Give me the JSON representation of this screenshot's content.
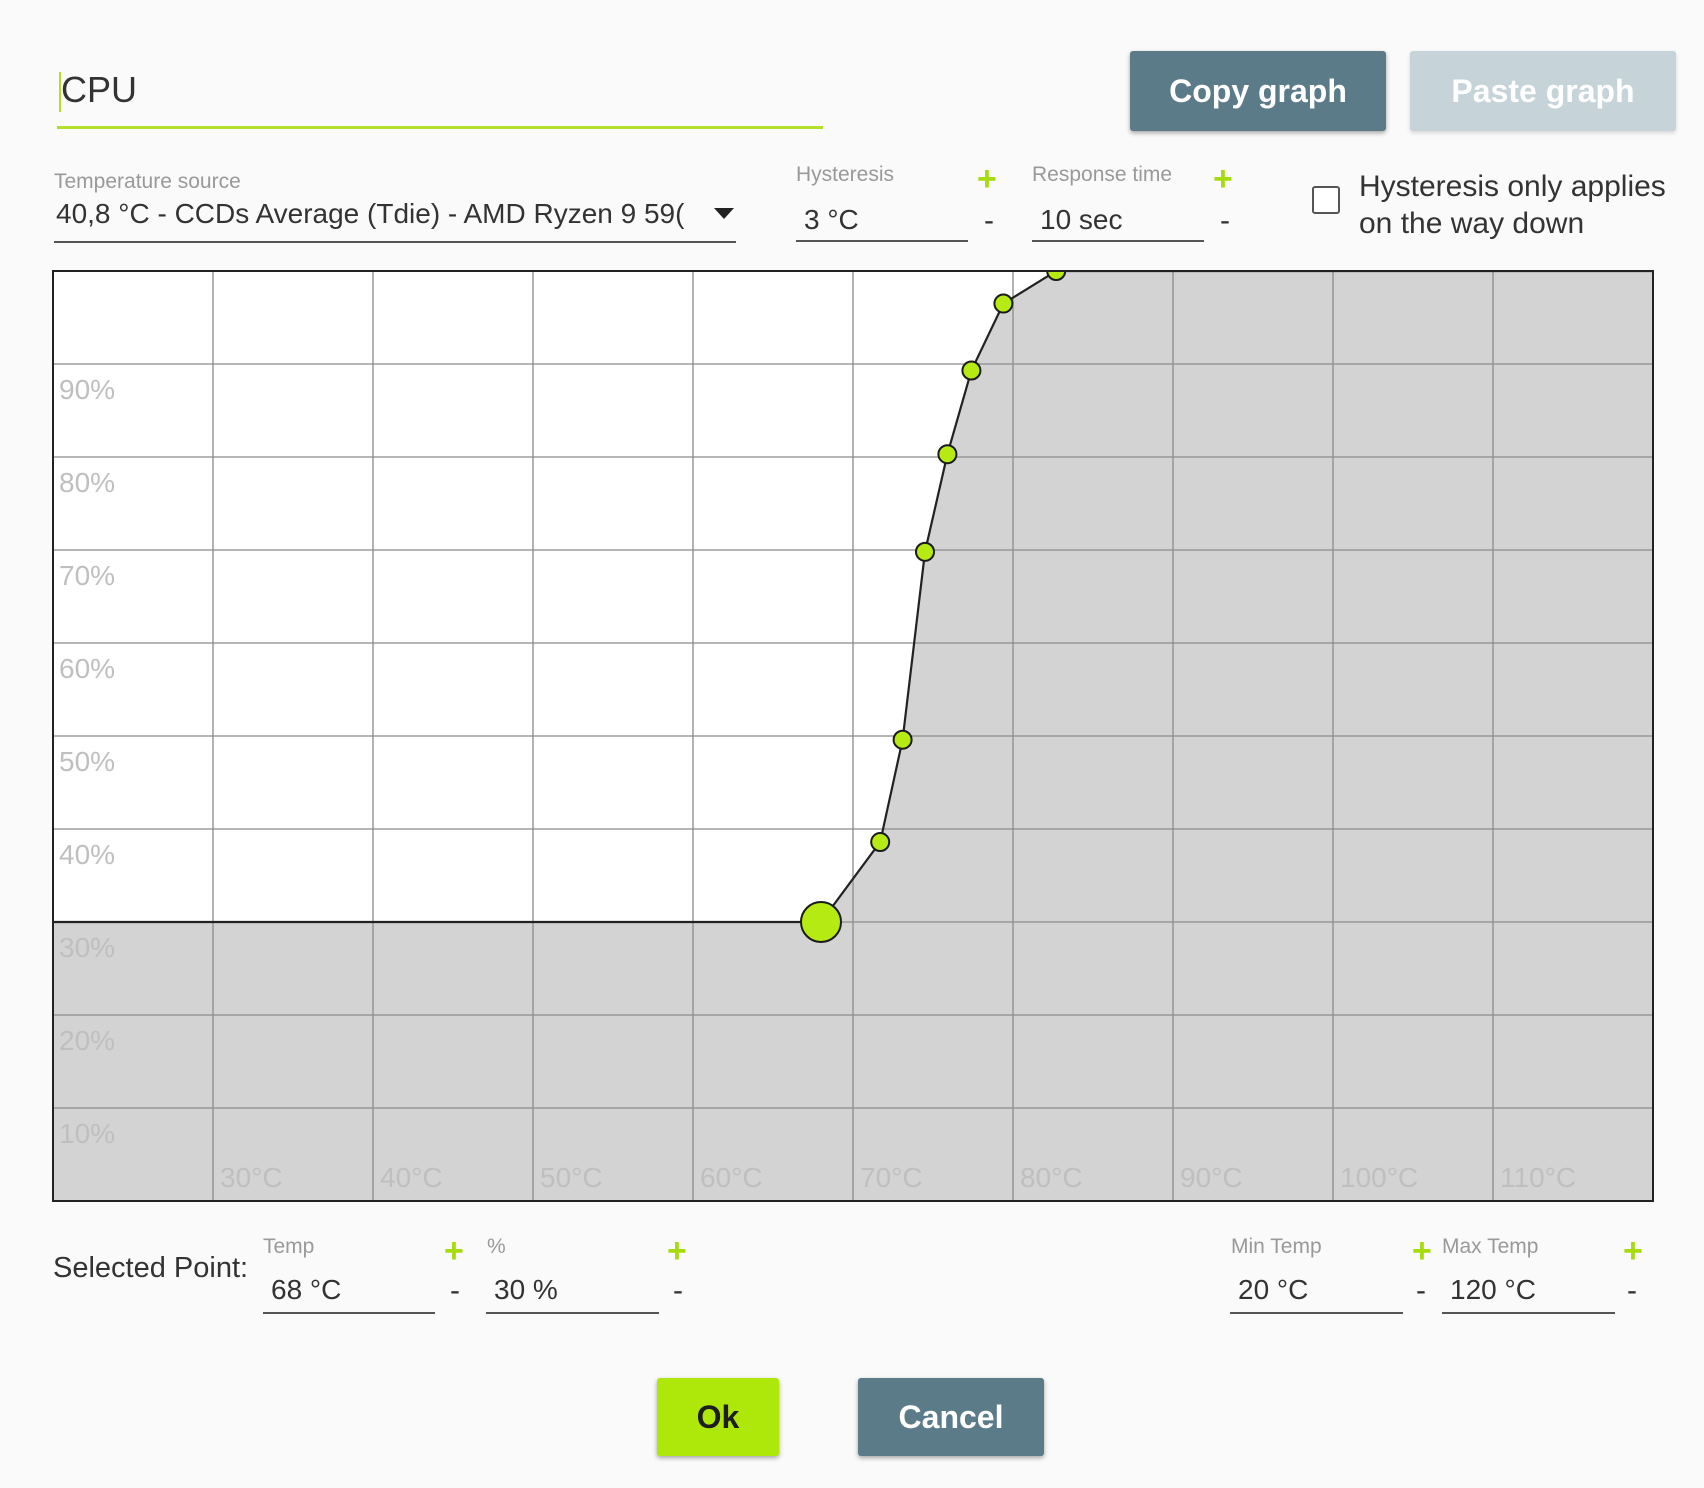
{
  "header": {
    "name_value": "CPU",
    "copy_graph_label": "Copy graph",
    "paste_graph_label": "Paste graph"
  },
  "settings": {
    "temperature_source_label": "Temperature source",
    "temperature_source_value": "40,8 °C - CCDs Average (Tdie) - AMD Ryzen 9 59(",
    "hysteresis_label": "Hysteresis",
    "hysteresis_value": "3 °C",
    "response_time_label": "Response time",
    "response_time_value": "10 sec",
    "hysteresis_down_label": "Hysteresis only applies on the way down",
    "hysteresis_down_checked": false,
    "plus": "+",
    "minus": "-"
  },
  "chart_data": {
    "type": "area",
    "xlim": [
      20,
      120
    ],
    "ylim": [
      0,
      100
    ],
    "x_ticks": [
      "30°C",
      "40°C",
      "50°C",
      "60°C",
      "70°C",
      "80°C",
      "90°C",
      "100°C",
      "110°C"
    ],
    "y_ticks": [
      "10%",
      "20%",
      "30%",
      "40%",
      "50%",
      "60%",
      "70%",
      "80%",
      "90%"
    ],
    "grid": true,
    "selected_index": 1,
    "points": [
      {
        "x": 20,
        "y": 30
      },
      {
        "x": 68,
        "y": 30
      },
      {
        "x": 71.7,
        "y": 38.6
      },
      {
        "x": 73.1,
        "y": 49.6
      },
      {
        "x": 74.5,
        "y": 69.8
      },
      {
        "x": 75.9,
        "y": 80.3
      },
      {
        "x": 77.4,
        "y": 89.3
      },
      {
        "x": 79.4,
        "y": 96.5
      },
      {
        "x": 82.7,
        "y": 100
      },
      {
        "x": 120,
        "y": 100
      }
    ],
    "colors": {
      "fill": "#d3d3d3",
      "grid": "#8a8a8a",
      "point": "#b5ea12",
      "tick": "#bfbfbf"
    }
  },
  "selected_point": {
    "label": "Selected Point:",
    "temp_label": "Temp",
    "temp_value": "68 °C",
    "percent_label": "%",
    "percent_value": "30 %",
    "min_temp_label": "Min Temp",
    "min_temp_value": "20 °C",
    "max_temp_label": "Max Temp",
    "max_temp_value": "120 °C"
  },
  "footer": {
    "ok_label": "Ok",
    "cancel_label": "Cancel"
  }
}
